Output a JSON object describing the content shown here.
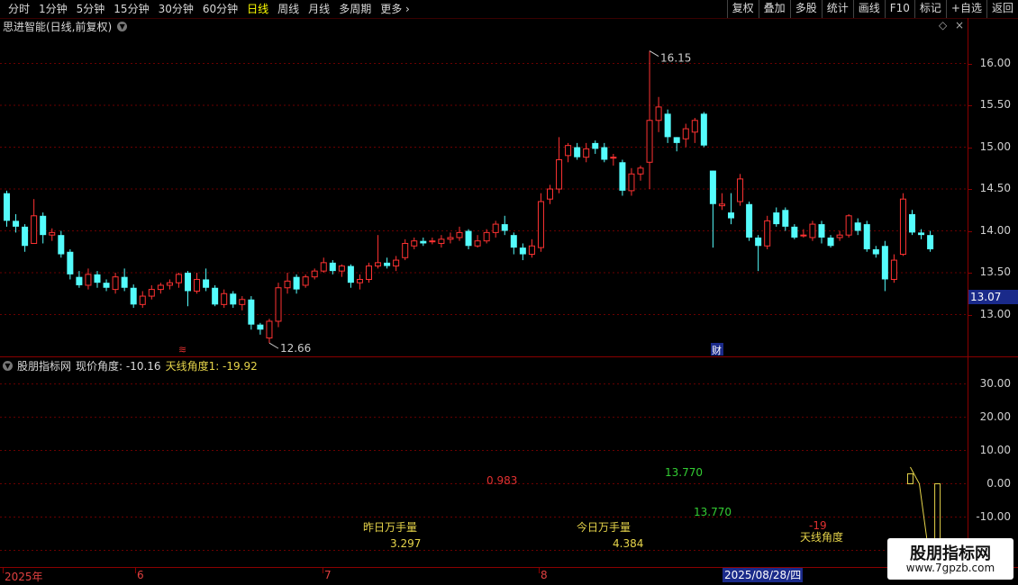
{
  "toolbar": {
    "periods": [
      "分时",
      "1分钟",
      "5分钟",
      "15分钟",
      "30分钟",
      "60分钟",
      "日线",
      "周线",
      "月线",
      "多周期",
      "更多"
    ],
    "active_period": "日线",
    "right_buttons": [
      "复权",
      "叠加",
      "多股",
      "统计",
      "画线",
      "F10",
      "标记",
      "+自选",
      "返回"
    ]
  },
  "chart_header": {
    "title": "思进智能(日线,前复权)"
  },
  "main_chart": {
    "y_ticks": [
      "16.00",
      "15.50",
      "15.00",
      "14.50",
      "14.00",
      "13.50",
      "13.00"
    ],
    "current_price": "13.07",
    "high_label": "16.15",
    "low_label": "12.66",
    "marker_cai": "财",
    "marker_red": "≋"
  },
  "indicator": {
    "name": "股朋指标网",
    "value1_text": "现价角度: -10.16",
    "value2_text": "天线角度1: -19.92",
    "y_ticks": [
      "30.00",
      "20.00",
      "10.00",
      "0.00",
      "-10.00",
      "-20.00"
    ],
    "labels": {
      "v0983": "0.983",
      "v13770a": "13.770",
      "v13770b": "13.770",
      "yesterday_label": "昨日万手量",
      "yesterday_value": "3.297",
      "today_label": "今日万手量",
      "today_value": "4.384",
      "neg19": "-19",
      "tianxian": "天线角度"
    }
  },
  "date_axis": {
    "labels": [
      "2025年",
      "6",
      "7",
      "8"
    ],
    "cursor_date": "2025/08/28/四"
  },
  "watermark": {
    "title": "股朋指标网",
    "url": "www.7gpzb.com"
  },
  "colors": {
    "up": "#ff3232",
    "down": "#54fcfc",
    "grid_red": "#8a0000",
    "yellow": "#e6d44a",
    "green": "#33cc33"
  },
  "chart_data": {
    "type": "candlestick",
    "ylim": [
      12.5,
      16.35
    ],
    "candles": [
      [
        14.45,
        14.12,
        14.48,
        14.05
      ],
      [
        14.12,
        14.05,
        14.2,
        13.98
      ],
      [
        14.05,
        13.82,
        14.08,
        13.75
      ],
      [
        13.85,
        14.18,
        14.38,
        13.85
      ],
      [
        14.18,
        13.95,
        14.22,
        13.85
      ],
      [
        13.95,
        13.98,
        14.03,
        13.88
      ],
      [
        13.95,
        13.72,
        14.0,
        13.68
      ],
      [
        13.75,
        13.48,
        13.78,
        13.42
      ],
      [
        13.45,
        13.35,
        13.52,
        13.32
      ],
      [
        13.35,
        13.48,
        13.55,
        13.3
      ],
      [
        13.48,
        13.38,
        13.52,
        13.32
      ],
      [
        13.38,
        13.32,
        13.42,
        13.28
      ],
      [
        13.3,
        13.45,
        13.5,
        13.25
      ],
      [
        13.45,
        13.32,
        13.55,
        13.28
      ],
      [
        13.32,
        13.12,
        13.36,
        13.08
      ],
      [
        13.12,
        13.22,
        13.28,
        13.08
      ],
      [
        13.22,
        13.3,
        13.35,
        13.18
      ],
      [
        13.3,
        13.35,
        13.38,
        13.25
      ],
      [
        13.35,
        13.38,
        13.42,
        13.3
      ],
      [
        13.38,
        13.48,
        13.5,
        13.32
      ],
      [
        13.5,
        13.28,
        13.52,
        13.1
      ],
      [
        13.28,
        13.42,
        13.5,
        13.25
      ],
      [
        13.42,
        13.32,
        13.55,
        13.28
      ],
      [
        13.32,
        13.12,
        13.35,
        13.1
      ],
      [
        13.12,
        13.25,
        13.3,
        13.08
      ],
      [
        13.25,
        13.12,
        13.28,
        13.08
      ],
      [
        13.12,
        13.18,
        13.22,
        13.05
      ],
      [
        13.18,
        12.88,
        13.22,
        12.82
      ],
      [
        12.88,
        12.82,
        12.9,
        12.76
      ],
      [
        12.72,
        12.92,
        12.95,
        12.66
      ],
      [
        12.92,
        13.32,
        13.38,
        12.85
      ],
      [
        13.32,
        13.4,
        13.5,
        13.25
      ],
      [
        13.45,
        13.3,
        13.48,
        13.25
      ],
      [
        13.35,
        13.45,
        13.48,
        13.32
      ],
      [
        13.45,
        13.52,
        13.55,
        13.42
      ],
      [
        13.52,
        13.62,
        13.68,
        13.5
      ],
      [
        13.62,
        13.52,
        13.65,
        13.48
      ],
      [
        13.52,
        13.58,
        13.6,
        13.45
      ],
      [
        13.58,
        13.38,
        13.6,
        13.32
      ],
      [
        13.38,
        13.42,
        13.48,
        13.3
      ],
      [
        13.42,
        13.58,
        13.62,
        13.38
      ],
      [
        13.58,
        13.62,
        13.95,
        13.55
      ],
      [
        13.62,
        13.58,
        13.68,
        13.55
      ],
      [
        13.58,
        13.65,
        13.7,
        13.52
      ],
      [
        13.68,
        13.85,
        13.9,
        13.65
      ],
      [
        13.82,
        13.88,
        13.92,
        13.78
      ],
      [
        13.88,
        13.85,
        13.92,
        13.82
      ],
      [
        13.88,
        13.88,
        13.92,
        13.84
      ],
      [
        13.85,
        13.9,
        13.95,
        13.8
      ],
      [
        13.9,
        13.92,
        13.98,
        13.85
      ],
      [
        13.92,
        13.98,
        14.05,
        13.88
      ],
      [
        14.0,
        13.82,
        14.02,
        13.78
      ],
      [
        13.82,
        13.88,
        13.95,
        13.8
      ],
      [
        13.88,
        13.98,
        14.02,
        13.85
      ],
      [
        13.98,
        14.08,
        14.12,
        13.92
      ],
      [
        14.08,
        14.0,
        14.18,
        13.95
      ],
      [
        13.95,
        13.8,
        13.98,
        13.72
      ],
      [
        13.8,
        13.72,
        13.85,
        13.65
      ],
      [
        13.72,
        13.82,
        13.9,
        13.68
      ],
      [
        13.8,
        14.35,
        14.45,
        13.75
      ],
      [
        14.38,
        14.5,
        14.55,
        14.32
      ],
      [
        14.5,
        14.85,
        15.12,
        14.45
      ],
      [
        14.9,
        15.02,
        15.05,
        14.82
      ],
      [
        15.0,
        14.88,
        15.05,
        14.85
      ],
      [
        14.88,
        14.98,
        15.05,
        14.82
      ],
      [
        15.05,
        14.98,
        15.08,
        14.92
      ],
      [
        15.0,
        14.85,
        15.05,
        14.82
      ],
      [
        14.88,
        14.88,
        14.92,
        14.78
      ],
      [
        14.82,
        14.48,
        14.85,
        14.42
      ],
      [
        14.48,
        14.68,
        14.75,
        14.42
      ],
      [
        14.68,
        14.75,
        14.78,
        14.6
      ],
      [
        14.82,
        15.32,
        16.15,
        14.5
      ],
      [
        15.32,
        15.48,
        15.6,
        15.18
      ],
      [
        15.4,
        15.12,
        15.45,
        15.05
      ],
      [
        15.12,
        15.05,
        15.12,
        14.95
      ],
      [
        15.1,
        15.22,
        15.28,
        15.0
      ],
      [
        15.18,
        15.32,
        15.35,
        15.05
      ],
      [
        15.4,
        15.02,
        15.42,
        15.0
      ],
      [
        14.72,
        14.32,
        14.72,
        13.8
      ],
      [
        14.3,
        14.32,
        14.45,
        14.25
      ],
      [
        14.22,
        14.15,
        14.45,
        14.08
      ],
      [
        14.35,
        14.62,
        14.68,
        14.3
      ],
      [
        14.32,
        13.92,
        14.35,
        13.88
      ],
      [
        13.92,
        13.82,
        13.95,
        13.52
      ],
      [
        13.82,
        14.12,
        14.18,
        13.78
      ],
      [
        14.22,
        14.08,
        14.28,
        14.05
      ],
      [
        14.25,
        14.05,
        14.28,
        14.0
      ],
      [
        14.05,
        13.92,
        14.08,
        13.9
      ],
      [
        13.95,
        13.95,
        14.02,
        13.92
      ],
      [
        13.92,
        14.08,
        14.12,
        13.88
      ],
      [
        14.08,
        13.92,
        14.12,
        13.85
      ],
      [
        13.92,
        13.82,
        13.95,
        13.8
      ],
      [
        13.92,
        13.95,
        14.0,
        13.88
      ],
      [
        13.95,
        14.18,
        14.2,
        13.92
      ],
      [
        14.1,
        14.0,
        14.15,
        13.95
      ],
      [
        14.08,
        13.78,
        14.12,
        13.75
      ],
      [
        13.78,
        13.72,
        13.82,
        13.68
      ],
      [
        13.82,
        13.42,
        13.88,
        13.28
      ],
      [
        13.42,
        13.65,
        13.72,
        13.38
      ],
      [
        13.72,
        14.38,
        14.45,
        13.7
      ],
      [
        14.2,
        13.98,
        14.25,
        13.95
      ],
      [
        13.98,
        13.95,
        14.02,
        13.9
      ],
      [
        13.95,
        13.78,
        14.0,
        13.75
      ]
    ],
    "indicator_series": {
      "name": "天线角度",
      "values": [
        5,
        0,
        -20,
        -19
      ]
    }
  }
}
